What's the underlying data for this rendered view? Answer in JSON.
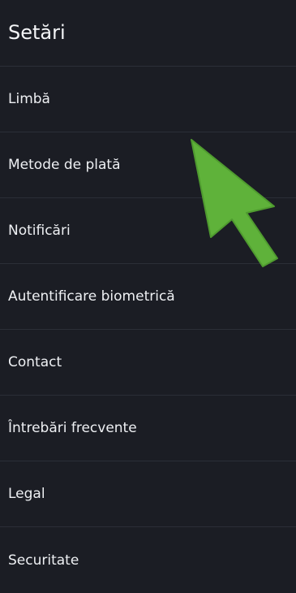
{
  "header": {
    "title": "Setări"
  },
  "settings": {
    "items": [
      {
        "label": "Limbă"
      },
      {
        "label": "Metode de plată"
      },
      {
        "label": "Notificări"
      },
      {
        "label": "Autentificare biometrică"
      },
      {
        "label": "Contact"
      },
      {
        "label": "Întrebări frecvente"
      },
      {
        "label": "Legal"
      },
      {
        "label": "Securitate"
      }
    ]
  },
  "annotation": {
    "icon": "arrow-pointer-icon",
    "color": "#5fb23a"
  },
  "colors": {
    "background": "#1b1d24",
    "divider": "#2b2e37",
    "text": "#eef0f3"
  }
}
